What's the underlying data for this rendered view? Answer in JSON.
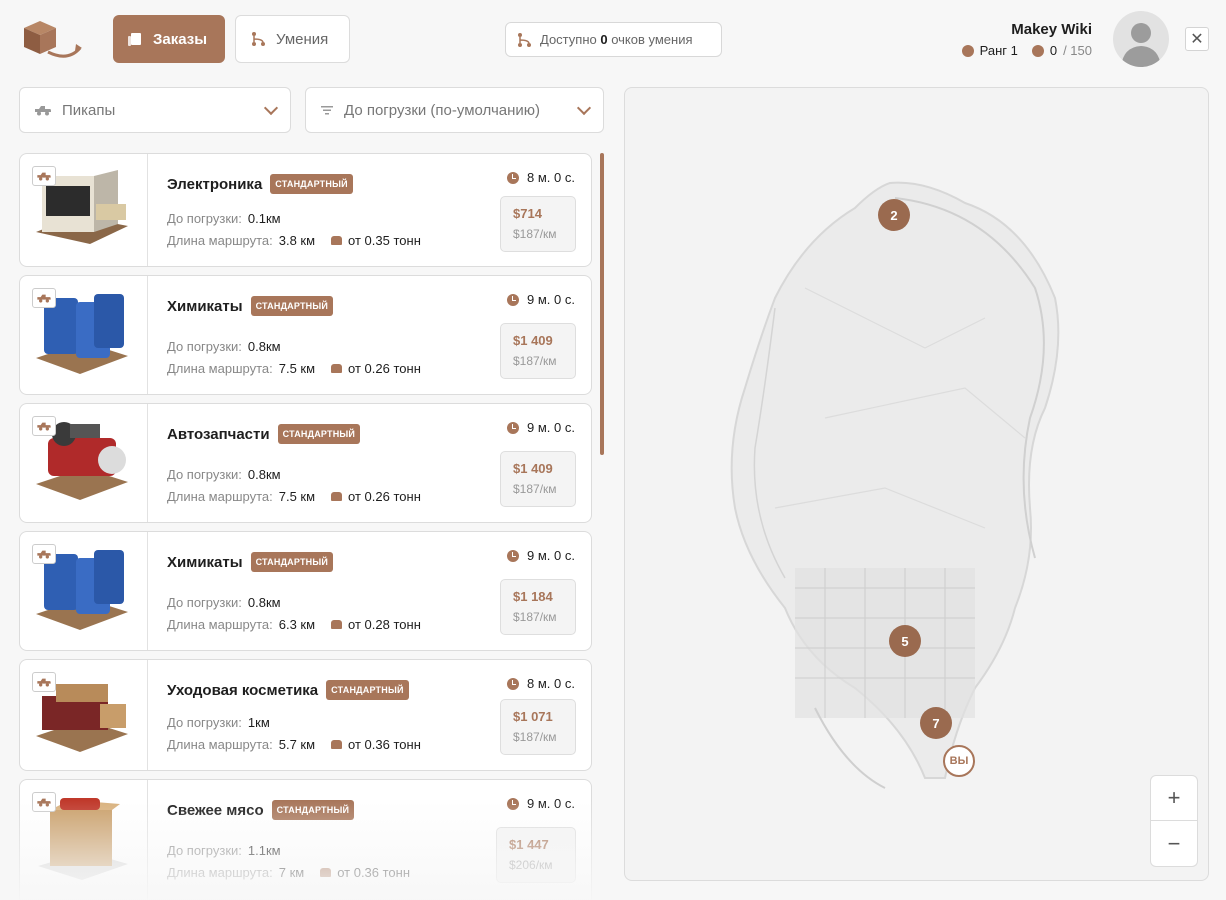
{
  "header": {
    "tabs": [
      {
        "label": "Заказы",
        "active": true
      },
      {
        "label": "Умения",
        "active": false
      }
    ],
    "skill_points": {
      "prefix": "Доступно",
      "value": "0",
      "suffix": "очков умения"
    },
    "user": {
      "name": "Makey Wiki",
      "rank": "Ранг 1",
      "xp": "0",
      "xp_max": "/ 150"
    }
  },
  "filters": {
    "vehicle": "Пикапы",
    "sort": "До погрузки (по-умолчанию)"
  },
  "orders": [
    {
      "title": "Электроника",
      "badge": "СТАНДАРТНЫЙ",
      "to_load_label": "До погрузки:",
      "to_load": "0.1км",
      "route_label": "Длина маршрута:",
      "route": "3.8 км",
      "weight": "от 0.35 тонн",
      "time": "8 м. 0 с.",
      "price": "$714",
      "per_km": "$187/км"
    },
    {
      "title": "Химикаты",
      "badge": "СТАНДАРТНЫЙ",
      "to_load_label": "До погрузки:",
      "to_load": "0.8км",
      "route_label": "Длина маршрута:",
      "route": "7.5 км",
      "weight": "от 0.26 тонн",
      "time": "9 м. 0 с.",
      "price": "$1 409",
      "per_km": "$187/км"
    },
    {
      "title": "Автозапчасти",
      "badge": "СТАНДАРТНЫЙ",
      "to_load_label": "До погрузки:",
      "to_load": "0.8км",
      "route_label": "Длина маршрута:",
      "route": "7.5 км",
      "weight": "от 0.26 тонн",
      "time": "9 м. 0 с.",
      "price": "$1 409",
      "per_km": "$187/км"
    },
    {
      "title": "Химикаты",
      "badge": "СТАНДАРТНЫЙ",
      "to_load_label": "До погрузки:",
      "to_load": "0.8км",
      "route_label": "Длина маршрута:",
      "route": "6.3 км",
      "weight": "от 0.28 тонн",
      "time": "9 м. 0 с.",
      "price": "$1 184",
      "per_km": "$187/км"
    },
    {
      "title": "Уходовая косметика",
      "badge": "СТАНДАРТНЫЙ",
      "to_load_label": "До погрузки:",
      "to_load": "1км",
      "route_label": "Длина маршрута:",
      "route": "5.7 км",
      "weight": "от 0.36 тонн",
      "time": "8 м. 0 с.",
      "price": "$1 071",
      "per_km": "$187/км"
    },
    {
      "title": "Свежее мясо",
      "badge": "СТАНДАРТНЫЙ",
      "to_load_label": "До погрузки:",
      "to_load": "1.1км",
      "route_label": "Длина маршрута:",
      "route": "7 км",
      "weight": "от 0.36 тонн",
      "time": "9 м. 0 с.",
      "price": "$1 447",
      "per_km": "$206/км"
    }
  ],
  "map": {
    "pins": [
      "2",
      "5",
      "7"
    ],
    "you_label": "ВЫ",
    "zoom_in": "+",
    "zoom_out": "−"
  },
  "colors": {
    "accent": "#a8765a"
  }
}
